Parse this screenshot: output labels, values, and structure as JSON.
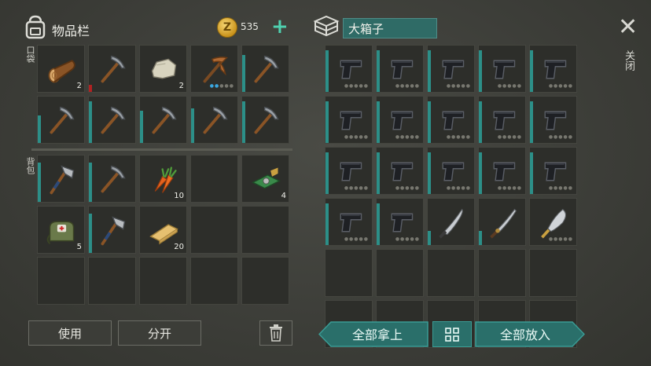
{
  "inventory": {
    "title": "物品栏",
    "coin_count": "535",
    "coin_symbol": "Z",
    "pocket_label": "口袋",
    "backpack_label": "背包",
    "use_button": "使用",
    "split_button": "分开",
    "pocket_slots": [
      {
        "item": "log-icon",
        "count": "2"
      },
      {
        "item": "pickaxe-icon",
        "durability": 0.15,
        "dura_color": "red"
      },
      {
        "item": "stone-icon",
        "count": "2"
      },
      {
        "item": "copper-pickaxe-icon",
        "dots": 2
      },
      {
        "item": "pickaxe-icon",
        "durability": 0.8
      },
      {
        "item": "pickaxe-icon",
        "durability": 0.6
      },
      {
        "item": "pickaxe-icon",
        "durability": 0.9
      },
      {
        "item": "pickaxe-icon",
        "durability": 0.7
      },
      {
        "item": "pickaxe-icon",
        "durability": 0.75
      },
      {
        "item": "pickaxe-icon",
        "durability": 0.9
      }
    ],
    "backpack_slots": [
      {
        "item": "hatchet-icon",
        "durability": 0.85
      },
      {
        "item": "pickaxe-icon",
        "durability": 0.85
      },
      {
        "item": "carrot-icon",
        "count": "10"
      },
      {
        "item": "empty"
      },
      {
        "item": "circuit-board-icon",
        "count": "4"
      },
      {
        "item": "medkit-bag-icon",
        "count": "5"
      },
      {
        "item": "hatchet-icon",
        "durability": 0.85
      },
      {
        "item": "plank-icon",
        "count": "20"
      },
      {
        "item": "empty"
      },
      {
        "item": "empty"
      },
      {
        "item": "empty"
      },
      {
        "item": "empty"
      },
      {
        "item": "empty"
      },
      {
        "item": "empty"
      },
      {
        "item": "empty"
      }
    ]
  },
  "box": {
    "title": "大箱子",
    "take_all_button": "全部拿上",
    "put_all_button": "全部放入",
    "slots": [
      {
        "item": "pistol-icon",
        "dots": 5,
        "durability": 0.9
      },
      {
        "item": "pistol-icon",
        "dots": 5,
        "durability": 0.9
      },
      {
        "item": "pistol-icon",
        "dots": 5,
        "durability": 0.9
      },
      {
        "item": "pistol-icon",
        "dots": 5,
        "durability": 0.9
      },
      {
        "item": "pistol-icon",
        "dots": 5,
        "durability": 0.9
      },
      {
        "item": "pistol-icon",
        "dots": 5,
        "durability": 0.9
      },
      {
        "item": "pistol-icon",
        "dots": 5,
        "durability": 0.9
      },
      {
        "item": "pistol-icon",
        "dots": 5,
        "durability": 0.9
      },
      {
        "item": "pistol-icon",
        "dots": 5,
        "durability": 0.9
      },
      {
        "item": "pistol-icon",
        "dots": 5,
        "durability": 0.9
      },
      {
        "item": "pistol-icon",
        "dots": 5,
        "durability": 0.9
      },
      {
        "item": "pistol-icon",
        "dots": 5,
        "durability": 0.9
      },
      {
        "item": "pistol-icon",
        "dots": 5,
        "durability": 0.9
      },
      {
        "item": "pistol-icon",
        "dots": 5,
        "durability": 0.9
      },
      {
        "item": "pistol-icon",
        "dots": 5,
        "durability": 0.9
      },
      {
        "item": "pistol-icon",
        "dots": 5,
        "durability": 0.9
      },
      {
        "item": "pistol-icon",
        "dots": 5,
        "durability": 0.9
      },
      {
        "item": "machete-icon",
        "durability": 0.3
      },
      {
        "item": "katana-icon",
        "durability": 0.3
      },
      {
        "item": "cleaver-icon",
        "dots": 2
      },
      {
        "item": "empty"
      },
      {
        "item": "empty"
      },
      {
        "item": "empty"
      },
      {
        "item": "empty"
      },
      {
        "item": "empty"
      },
      {
        "item": "empty"
      },
      {
        "item": "empty"
      },
      {
        "item": "empty"
      },
      {
        "item": "empty"
      },
      {
        "item": "empty"
      }
    ]
  },
  "close_label": "关闭",
  "colors": {
    "teal": "#2c8f88",
    "coin": "#e0b43a",
    "accent": "#4fd1b0"
  }
}
